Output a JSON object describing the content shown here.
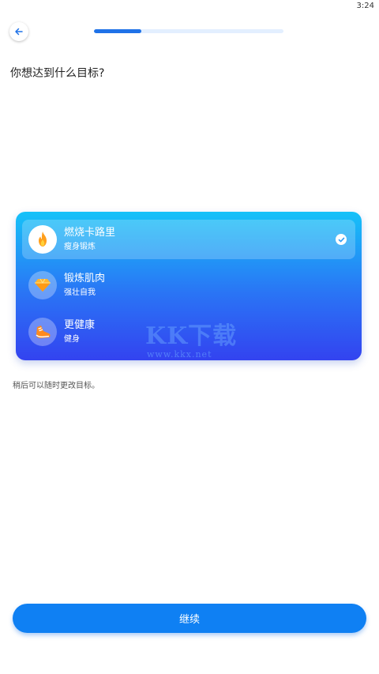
{
  "status": {
    "time": "3:24"
  },
  "header": {
    "back_icon": "arrow-left-icon",
    "progress": 0.25,
    "accent": "#1f72e8"
  },
  "question": "你想达到什么目标?",
  "goals": [
    {
      "title": "燃烧卡路里",
      "subtitle": "瘦身锻炼",
      "icon": "flame-icon",
      "selected": true
    },
    {
      "title": "锻炼肌肉",
      "subtitle": "强壮自我",
      "icon": "diamond-icon",
      "selected": false
    },
    {
      "title": "更健康",
      "subtitle": "健身",
      "icon": "running-shoe-icon",
      "selected": false
    }
  ],
  "watermark": {
    "text": "KK下载",
    "url": "www.kkx.net"
  },
  "hint": "稍后可以随时更改目标。",
  "continue_label": "继续",
  "colors": {
    "card_gradient_top": "#16c2f8",
    "card_gradient_bottom": "#3343f0",
    "button": "#0f80f3"
  }
}
